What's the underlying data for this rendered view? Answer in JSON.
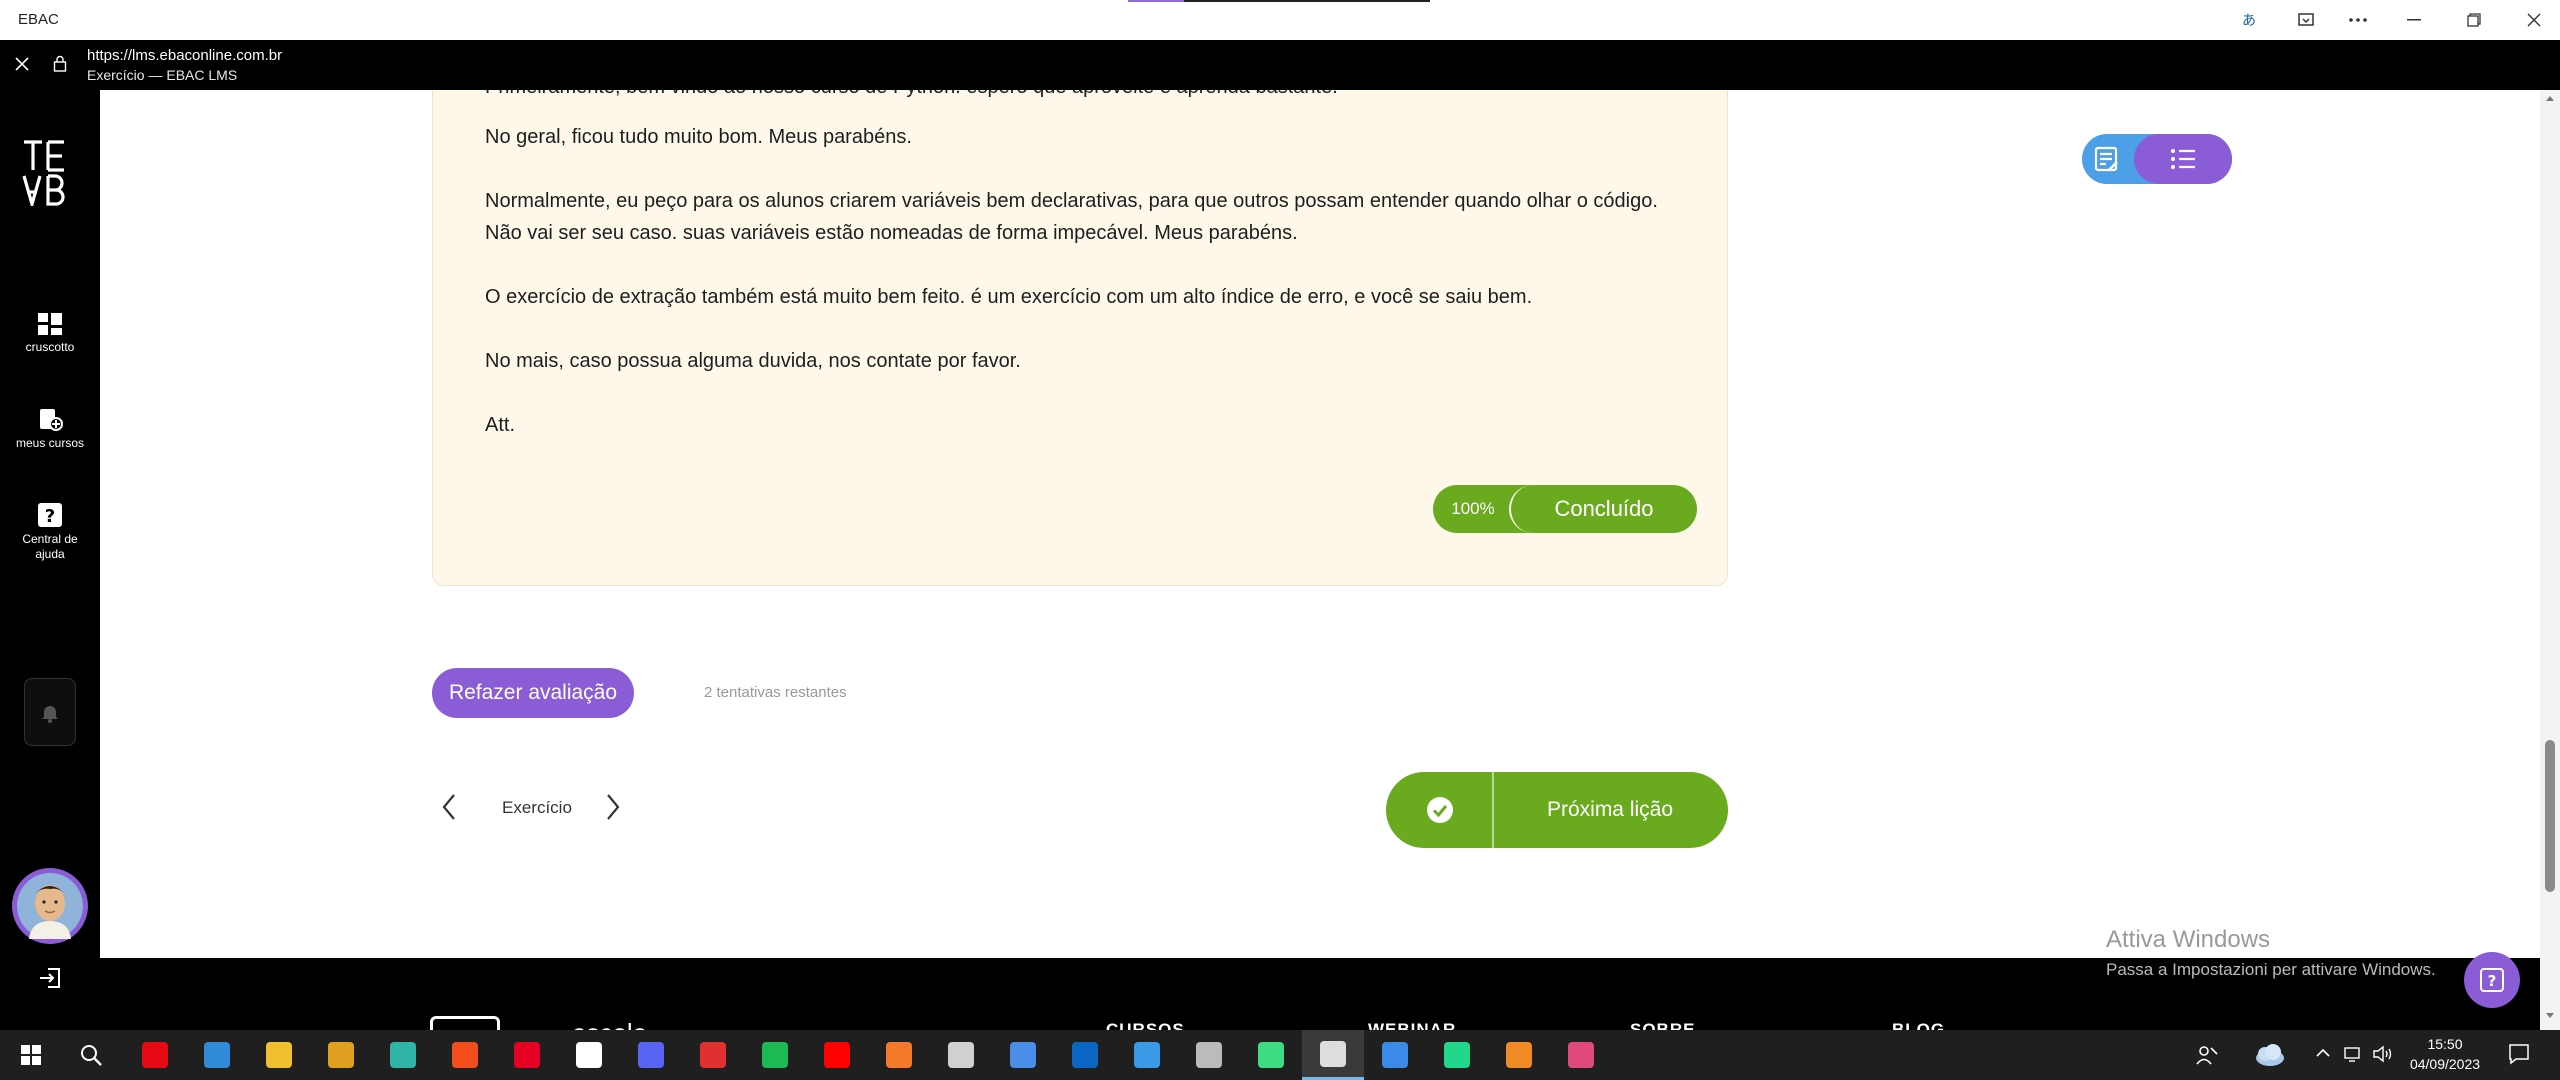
{
  "window": {
    "title": "EBAC",
    "translate_icon": "translate-icon",
    "collections_icon": "collections-icon",
    "more_icon": "more-icon",
    "minimize_icon": "minimize-icon",
    "restore_icon": "restore-icon",
    "close_icon": "close-icon"
  },
  "urlbar": {
    "url": "https://lms.ebaconline.com.br",
    "page_title": "Exercício — EBAC LMS"
  },
  "sidebar": {
    "logo": "EBAC",
    "items": [
      {
        "label": "cruscotto",
        "icon": "dashboard-icon"
      },
      {
        "label": "meus cursos",
        "icon": "courses-icon"
      },
      {
        "label": "Central de ajuda",
        "icon": "help-icon"
      }
    ]
  },
  "feedback": {
    "partial_first_line": "Primeiramente, bem vindo ao nosso curso de Python. espero que aproveite e aprenda bastante.",
    "line1": "No geral, ficou tudo muito bom. Meus parabéns.",
    "line2": "Normalmente, eu peço para os alunos criarem variáveis bem declarativas, para que outros possam entender quando olhar o código.",
    "line3": "Não vai ser seu caso. suas variáveis estão nomeadas de forma impecável. Meus parabéns.",
    "line4": "O exercício de extração também está muito bem feito. é um exercício com um alto índice de erro, e você se saiu bem.",
    "line5": "No mais, caso possua alguma duvida, nos contate por favor.",
    "signoff": "Att."
  },
  "grade": {
    "percent": "100%",
    "status": "Concluído"
  },
  "actions": {
    "redo_label": "Refazer avaliação",
    "attempts": "2 tentativas restantes",
    "nav_title": "Exercício",
    "next_lesson": "Próxima lição"
  },
  "footer": {
    "logo_text": "escola",
    "items": [
      "CURSOS",
      "WEBINAR",
      "SOBRE",
      "BLOG"
    ]
  },
  "watermark": {
    "title": "Attiva Windows",
    "subtitle": "Passa a Impostazioni per attivare Windows."
  },
  "taskbar": {
    "time": "15:50",
    "date": "04/09/2023",
    "apps": [
      {
        "name": "netflix",
        "color": "#e50914"
      },
      {
        "name": "vscode",
        "color": "#2f8ad8"
      },
      {
        "name": "file-explorer",
        "color": "#f0c030"
      },
      {
        "name": "slack",
        "color": "#e0a020"
      },
      {
        "name": "edge",
        "color": "#2fb4a8"
      },
      {
        "name": "figma",
        "color": "#f24e1e"
      },
      {
        "name": "pinterest",
        "color": "#e60023"
      },
      {
        "name": "notion",
        "color": "#ffffff"
      },
      {
        "name": "discord",
        "color": "#5865f2"
      },
      {
        "name": "recorder",
        "color": "#e03030"
      },
      {
        "name": "spotify",
        "color": "#1db954"
      },
      {
        "name": "youtube",
        "color": "#ff0000"
      },
      {
        "name": "blender",
        "color": "#f5792a"
      },
      {
        "name": "unreal",
        "color": "#d0d0d0"
      },
      {
        "name": "translator",
        "color": "#4a8ee8"
      },
      {
        "name": "linkedin",
        "color": "#0a66c2"
      },
      {
        "name": "store",
        "color": "#3a9ae8"
      },
      {
        "name": "calculator",
        "color": "#bbbbbb"
      },
      {
        "name": "android-studio",
        "color": "#3ddc84"
      },
      {
        "name": "snipping",
        "color": "#dddddd"
      },
      {
        "name": "todo",
        "color": "#3c8ae8"
      },
      {
        "name": "pycharm",
        "color": "#21d789"
      },
      {
        "name": "addin",
        "color": "#f08a24"
      },
      {
        "name": "figma-alt",
        "color": "#e04a7a"
      }
    ]
  }
}
